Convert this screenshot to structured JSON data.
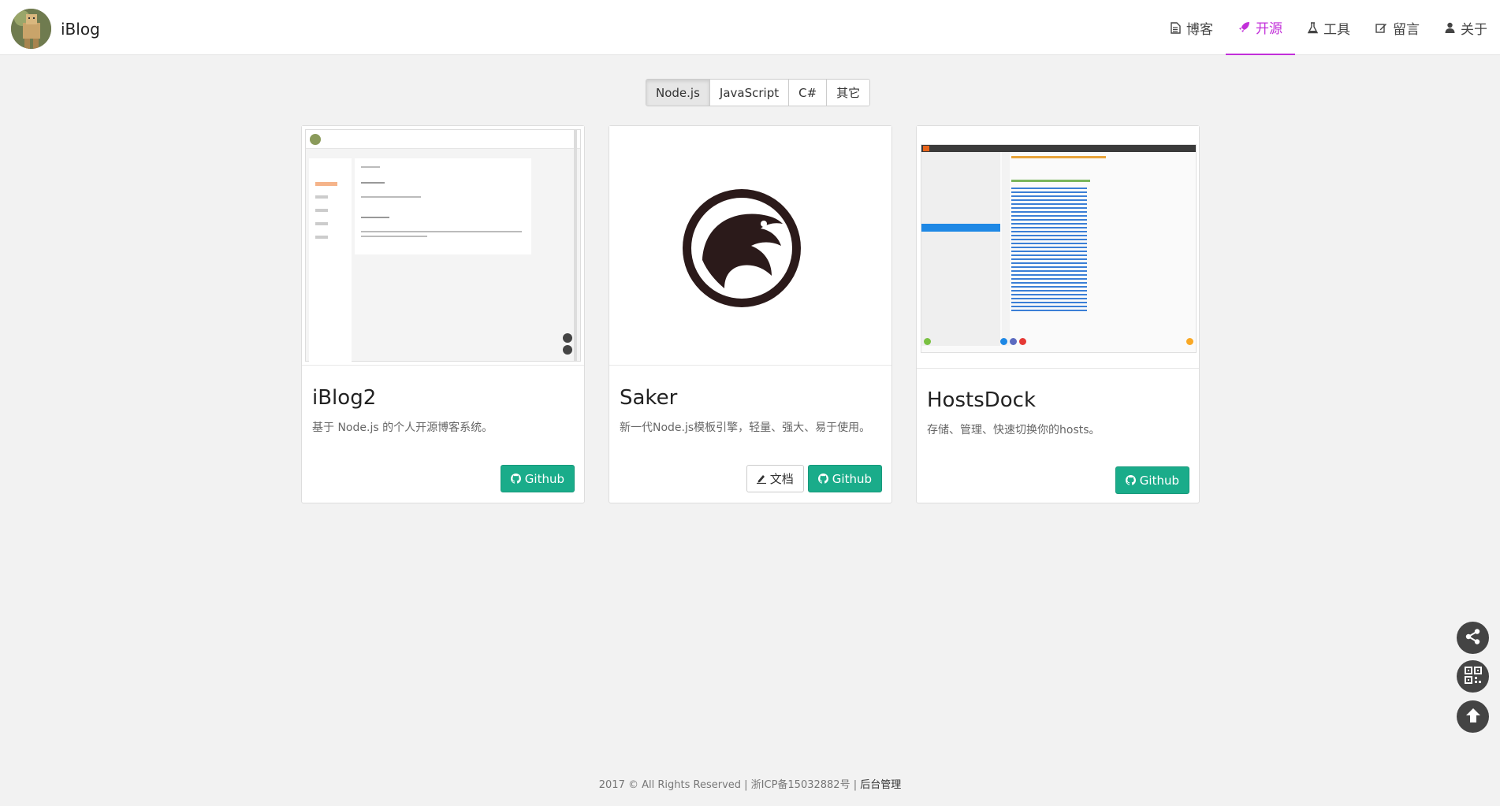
{
  "header": {
    "brand": "iBlog",
    "nav": [
      {
        "label": "博客",
        "icon": "file-icon"
      },
      {
        "label": "开源",
        "icon": "rocket-icon",
        "active": true
      },
      {
        "label": "工具",
        "icon": "flask-icon"
      },
      {
        "label": "留言",
        "icon": "edit-icon"
      },
      {
        "label": "关于",
        "icon": "user-icon"
      }
    ]
  },
  "tabs": [
    {
      "label": "Node.js",
      "active": true
    },
    {
      "label": "JavaScript"
    },
    {
      "label": "C#"
    },
    {
      "label": "其它"
    }
  ],
  "cards": [
    {
      "title": "iBlog2",
      "desc": "基于 Node.js 的个人开源博客系统。",
      "buttons": [
        {
          "label": "Github",
          "icon": "github-icon"
        }
      ]
    },
    {
      "title": "Saker",
      "desc": "新一代Node.js模板引擎，轻量、强大、易于使用。",
      "buttons": [
        {
          "label": "文档",
          "icon": "pen-icon"
        },
        {
          "label": "Github",
          "icon": "github-icon"
        }
      ]
    },
    {
      "title": "HostsDock",
      "desc": "存储、管理、快速切换你的hosts。",
      "buttons": [
        {
          "label": "Github",
          "icon": "github-icon"
        }
      ]
    }
  ],
  "footer": {
    "text": "2017 © All Rights Reserved | 浙ICP备15032882号 | ",
    "admin": "后台管理"
  },
  "colors": {
    "accent": "#c22fd9",
    "button": "#1aac8a",
    "background": "#f2f2f2"
  }
}
